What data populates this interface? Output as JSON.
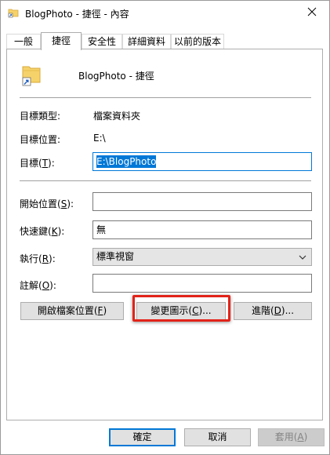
{
  "window": {
    "title": "BlogPhoto - 捷徑 - 內容"
  },
  "tabs": [
    {
      "label": "一般"
    },
    {
      "label": "捷徑",
      "active": true
    },
    {
      "label": "安全性"
    },
    {
      "label": "詳細資料"
    },
    {
      "label": "以前的版本"
    }
  ],
  "shortcut": {
    "name": "BlogPhoto - 捷徑",
    "target_type_label": "目標類型:",
    "target_type_value": "檔案資料夾",
    "target_location_label": "目標位置:",
    "target_location_value": "E:\\",
    "target_label_prefix": "目標(",
    "target_label_key": "T",
    "target_label_suffix": "):",
    "target_value": "E:\\BlogPhoto",
    "start_in_label_prefix": "開始位置(",
    "start_in_label_key": "S",
    "start_in_label_suffix": "):",
    "start_in_value": "",
    "hotkey_label_prefix": "快速鍵(",
    "hotkey_label_key": "K",
    "hotkey_label_suffix": "):",
    "hotkey_value": "無",
    "run_label_prefix": "執行(",
    "run_label_key": "R",
    "run_label_suffix": "):",
    "run_value": "標準視窗",
    "comment_label_prefix": "註解(",
    "comment_label_key": "O",
    "comment_label_suffix": "):",
    "comment_value": ""
  },
  "actions": {
    "open_location_prefix": "開啟檔案位置(",
    "open_location_key": "F",
    "open_location_suffix": ")",
    "change_icon_prefix": "變更圖示(",
    "change_icon_key": "C",
    "change_icon_suffix": ")...",
    "advanced_prefix": "進階(",
    "advanced_key": "D",
    "advanced_suffix": ")..."
  },
  "footer": {
    "ok": "確定",
    "cancel": "取消",
    "apply_prefix": "套用(",
    "apply_key": "A",
    "apply_suffix": ")"
  },
  "icons": {
    "title": "folder-shortcut-icon",
    "shortcut": "folder-shortcut-icon",
    "close": "close-icon",
    "dropdown": "chevron-down-icon"
  },
  "colors": {
    "accent": "#0078d7",
    "highlight_frame": "#e2231a",
    "folder": "#f6d26b"
  }
}
